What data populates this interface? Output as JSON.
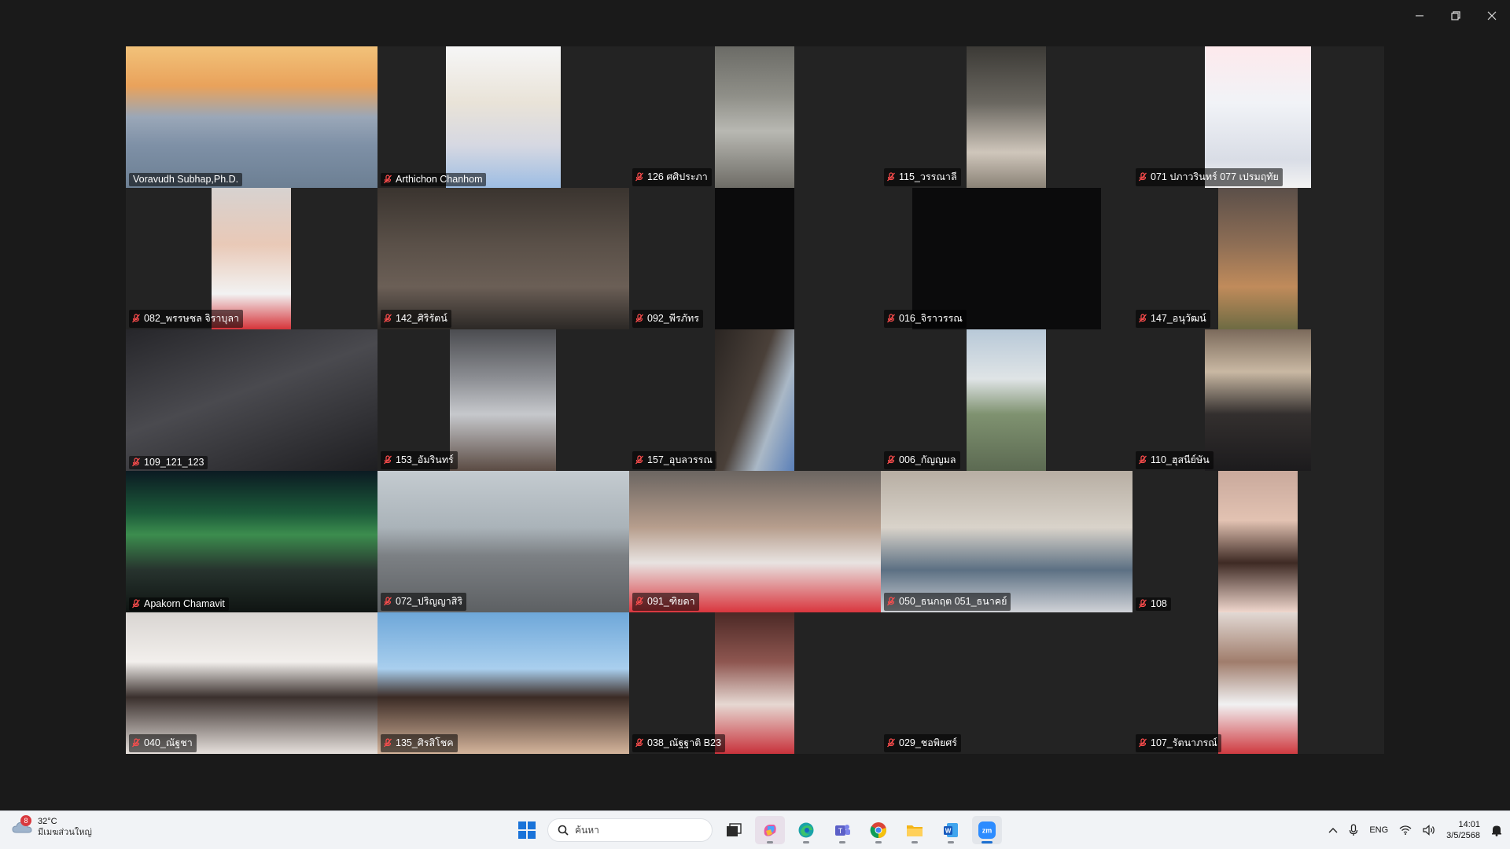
{
  "window": {
    "controls": [
      "minimize",
      "restore",
      "close"
    ]
  },
  "gallery": {
    "participants": [
      {
        "name": "Voravudh Subhap,Ph.D.",
        "muted": false,
        "active": true,
        "video": true,
        "bg": "bg-bridge",
        "vw": 320,
        "vx": 0
      },
      {
        "name": "Arthichon Chanhom",
        "muted": true,
        "video": true,
        "bg": "bg-room",
        "vw": 146,
        "vx": 87
      },
      {
        "name": "126 ศศิประภา",
        "muted": true,
        "video": true,
        "bg": "bg-bus",
        "vw": 101,
        "vx": 109
      },
      {
        "name": "115_วรรณาลี",
        "muted": true,
        "video": true,
        "bg": "bg-bus2",
        "vw": 101,
        "vx": 109
      },
      {
        "name": "071 ปภาวรินทร์ 077 เปรมฤทัย",
        "muted": true,
        "video": true,
        "bg": "bg-light",
        "vw": 135,
        "vx": 92
      },
      {
        "name": "082_พรรษชล จิราบุลา",
        "muted": true,
        "video": true,
        "bg": "bg-face",
        "vw": 101,
        "vx": 109
      },
      {
        "name": "142_ศิริรัตน์",
        "muted": true,
        "video": true,
        "bg": "bg-cafe",
        "vw": 320,
        "vx": 0
      },
      {
        "name": "092_พีรภัทร",
        "muted": true,
        "video": true,
        "bg": "bg-dark",
        "vw": 101,
        "vx": 109
      },
      {
        "name": "016_จิราวรรณ",
        "muted": true,
        "video": true,
        "bg": "bg-dark",
        "vw": 240,
        "vx": 40
      },
      {
        "name": "147_อนุวัฒน์",
        "muted": true,
        "video": true,
        "bg": "bg-sunset",
        "vw": 101,
        "vx": 109
      },
      {
        "name": "109_121_123",
        "muted": true,
        "video": true,
        "bg": "bg-darkroom",
        "vw": 320,
        "vx": 0
      },
      {
        "name": "153_อัมรินทร์",
        "muted": true,
        "video": true,
        "bg": "bg-ceiling",
        "vw": 135,
        "vx": 92
      },
      {
        "name": "157_อุบลวรรณ",
        "muted": true,
        "video": true,
        "bg": "bg-hair",
        "vw": 101,
        "vx": 109
      },
      {
        "name": "006_กัญญมล",
        "muted": true,
        "video": true,
        "bg": "bg-city",
        "vw": 101,
        "vx": 109
      },
      {
        "name": "110_ฮุสนีย์ษัน",
        "muted": true,
        "video": true,
        "bg": "bg-hijab",
        "vw": 135,
        "vx": 92
      },
      {
        "name": "Apakorn Chamavit",
        "muted": true,
        "video": true,
        "bg": "bg-aurora",
        "vw": 320,
        "vx": 0
      },
      {
        "name": "072_ปริญญาสิริ",
        "muted": true,
        "video": true,
        "bg": "bg-rain",
        "vw": 320,
        "vx": 0
      },
      {
        "name": "091_ฑิยดา",
        "muted": true,
        "video": true,
        "bg": "bg-busred",
        "vw": 320,
        "vx": 0
      },
      {
        "name": "050_ธนกฤต 051_ธนาคย์",
        "muted": true,
        "video": true,
        "bg": "bg-busseat",
        "vw": 320,
        "vx": 0
      },
      {
        "name": "108",
        "muted": true,
        "video": true,
        "bg": "bg-selfie",
        "vw": 101,
        "vx": 109
      },
      {
        "name": "040_ณัฐชา",
        "muted": true,
        "video": true,
        "bg": "bg-group",
        "vw": 320,
        "vx": 0
      },
      {
        "name": "135_ศิรสิโชค",
        "muted": true,
        "video": true,
        "bg": "bg-sky",
        "vw": 320,
        "vx": 0
      },
      {
        "name": "038_ณัฐฐาติ B23",
        "muted": true,
        "video": true,
        "bg": "bg-bus3",
        "vw": 101,
        "vx": 109
      },
      {
        "name": "029_ชอพิยศร์",
        "muted": true,
        "video": false,
        "bg": "",
        "vw": 0,
        "vx": 0
      },
      {
        "name": "107_รัตนาภรณ์",
        "muted": true,
        "video": true,
        "bg": "bg-mask",
        "vw": 101,
        "vx": 109
      }
    ]
  },
  "taskbar": {
    "weather": {
      "badge": "8",
      "temp": "32°C",
      "desc": "มีเมฆส่วนใหญ่"
    },
    "search_placeholder": "ค้นหา",
    "apps": [
      "task-view",
      "copilot",
      "edge",
      "teams",
      "chrome",
      "file-explorer",
      "word",
      "zoom"
    ],
    "tray": {
      "language": "ENG",
      "time": "14:01",
      "date": "3/5/2568"
    }
  }
}
